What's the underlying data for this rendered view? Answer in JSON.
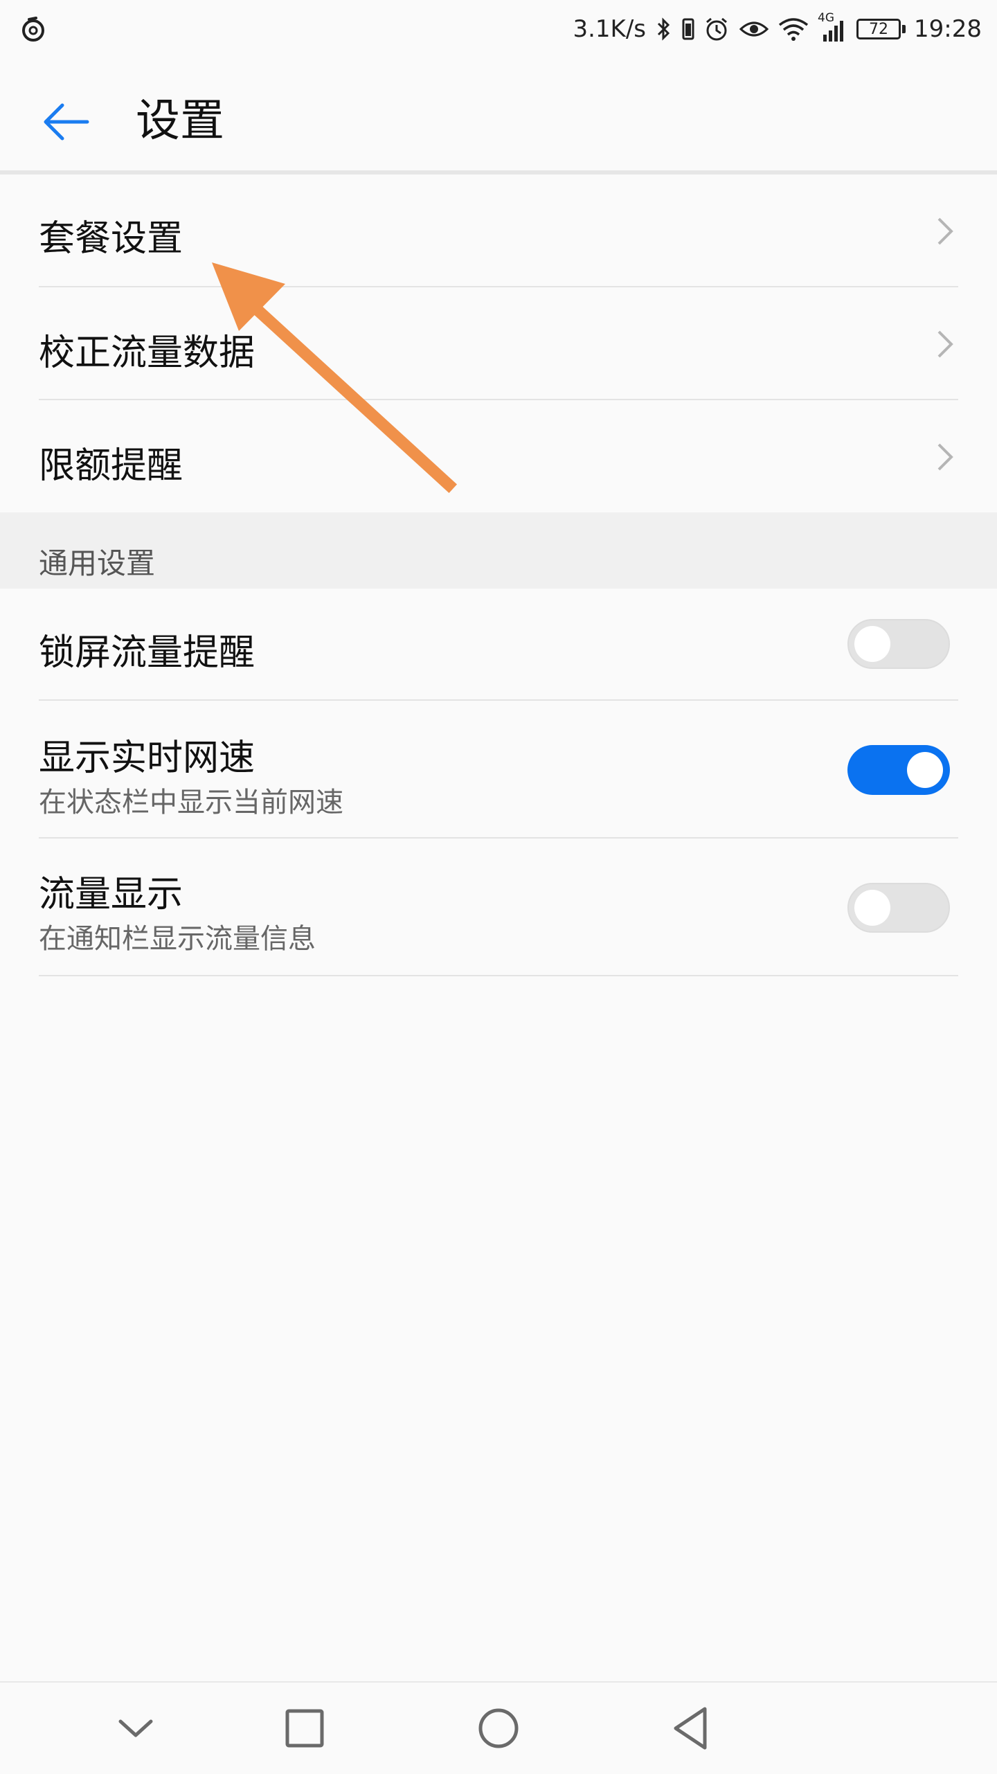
{
  "status_bar": {
    "net_speed": "3.1K/s",
    "network_type": "4G",
    "battery_level": "72",
    "time": "19:28",
    "icons": [
      "netease-icon",
      "bluetooth-icon",
      "vibrate-icon",
      "alarm-icon",
      "eye-icon",
      "wifi-icon",
      "signal-icon",
      "battery-icon"
    ]
  },
  "header": {
    "title": "设置",
    "back_icon": "arrow-left-icon",
    "accent_color": "#1a7cf0"
  },
  "items": [
    {
      "label": "套餐设置",
      "type": "link"
    },
    {
      "label": "校正流量数据",
      "type": "link"
    },
    {
      "label": "限额提醒",
      "type": "link"
    }
  ],
  "general": {
    "section_label": "通用设置",
    "toggles": [
      {
        "label": "锁屏流量提醒",
        "subtitle": "",
        "on": false
      },
      {
        "label": "显示实时网速",
        "subtitle": "在状态栏中显示当前网速",
        "on": true
      },
      {
        "label": "流量显示",
        "subtitle": "在通知栏显示流量信息",
        "on": false
      }
    ]
  },
  "nav_bar": {
    "buttons": [
      "collapse-icon",
      "recent-apps-icon",
      "home-icon",
      "back-icon"
    ]
  },
  "annotation": {
    "color": "#f0914a",
    "icon": "annotation-arrow-icon"
  }
}
